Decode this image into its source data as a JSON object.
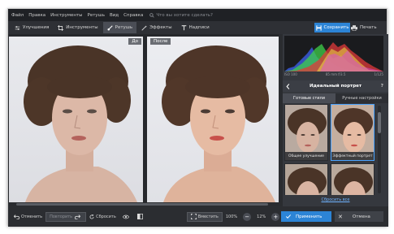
{
  "menu": {
    "items": [
      "Файл",
      "Правка",
      "Инструменты",
      "Ретушь",
      "Вид",
      "Справка"
    ],
    "ask_placeholder": "Что вы хотите сделать?"
  },
  "toolbar": {
    "tabs": [
      {
        "label": "Улучшения",
        "icon": "sliders-icon"
      },
      {
        "label": "Инструменты",
        "icon": "crop-icon"
      },
      {
        "label": "Ретушь",
        "icon": "brush-icon",
        "active": true
      },
      {
        "label": "Эффекты",
        "icon": "magic-wand-icon"
      },
      {
        "label": "Надписи",
        "icon": "text-icon"
      }
    ],
    "save_label": "Сохранить",
    "print_label": "Печать"
  },
  "canvas": {
    "before_label": "До",
    "after_label": "После"
  },
  "panel": {
    "histogram_info": [
      "ISO 100",
      "85 mm f/3.5",
      "1/125"
    ],
    "title": "Идеальный портрет",
    "help": "?",
    "tabs": [
      "Готовые стили",
      "Ручные настройки"
    ],
    "presets": [
      {
        "caption": "Общее улучшение"
      },
      {
        "caption": "Эффектный портрет",
        "selected": true
      },
      {
        "caption": ""
      },
      {
        "caption": ""
      }
    ],
    "reset_all": "Сбросить все"
  },
  "bottom": {
    "undo": "Отменить",
    "redo": "Повторить",
    "reset": "Сбросить",
    "fit": "Вместить",
    "zoom_fit": "100%",
    "zoom_current": "12%",
    "apply": "Применить",
    "cancel": "Отмена"
  },
  "colors": {
    "accent": "#2c84d6",
    "window_bg": "#3a3d44",
    "menubar_bg": "#1f2125"
  }
}
